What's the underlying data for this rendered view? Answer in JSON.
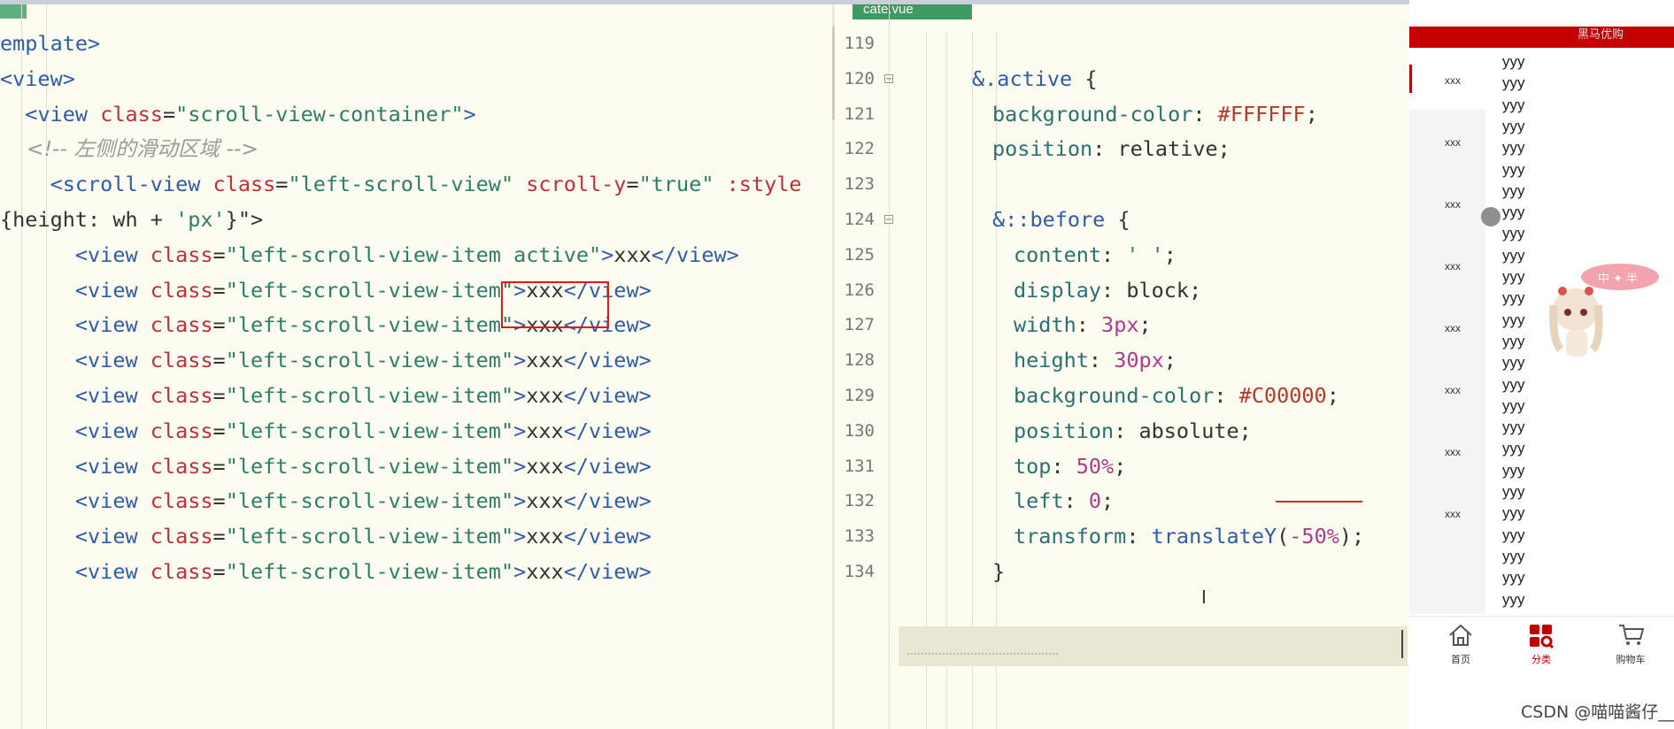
{
  "left_editor": {
    "lines": [
      {
        "parts": [
          [
            "tag",
            "emplate>"
          ]
        ]
      },
      {
        "parts": [
          [
            "tag",
            "<view>"
          ]
        ]
      },
      {
        "parts": [
          [
            "tag",
            "  <view "
          ],
          [
            "attr",
            "class"
          ],
          [
            "txt",
            "="
          ],
          [
            "str",
            "\"scroll-view-container\""
          ],
          [
            "tag",
            ">"
          ]
        ]
      },
      {
        "parts": [
          [
            "comment",
            "    <!-- 左侧的滑动区域 -->"
          ]
        ]
      },
      {
        "parts": [
          [
            "tag",
            "    <scroll-view "
          ],
          [
            "attr",
            "class"
          ],
          [
            "txt",
            "="
          ],
          [
            "str",
            "\"left-scroll-view\""
          ],
          [
            "txt",
            " "
          ],
          [
            "attr",
            "scroll-y"
          ],
          [
            "txt",
            "="
          ],
          [
            "str",
            "\"true\""
          ],
          [
            "txt",
            " "
          ],
          [
            "attr",
            ":style"
          ]
        ]
      },
      {
        "parts": [
          [
            "txt",
            "{height: wh + "
          ],
          [
            "str",
            "'px'"
          ],
          [
            "txt",
            "}\">"
          ]
        ]
      },
      {
        "parts": [
          [
            "tag",
            "      <view "
          ],
          [
            "attr",
            "class"
          ],
          [
            "txt",
            "="
          ],
          [
            "str",
            "\"left-scroll-view-item active\""
          ],
          [
            "tag",
            ">"
          ],
          [
            "txt",
            "xxx"
          ],
          [
            "tag",
            "</view>"
          ]
        ]
      },
      {
        "parts": [
          [
            "tag",
            "      <view "
          ],
          [
            "attr",
            "class"
          ],
          [
            "txt",
            "="
          ],
          [
            "str",
            "\"left-scroll-view-item\""
          ],
          [
            "tag",
            ">"
          ],
          [
            "txt",
            "xxx"
          ],
          [
            "tag",
            "</view>"
          ]
        ]
      },
      {
        "parts": [
          [
            "tag",
            "      <view "
          ],
          [
            "attr",
            "class"
          ],
          [
            "txt",
            "="
          ],
          [
            "str",
            "\"left-scroll-view-item\""
          ],
          [
            "tag",
            ">"
          ],
          [
            "txt",
            "xxx"
          ],
          [
            "tag",
            "</view>"
          ]
        ]
      },
      {
        "parts": [
          [
            "tag",
            "      <view "
          ],
          [
            "attr",
            "class"
          ],
          [
            "txt",
            "="
          ],
          [
            "str",
            "\"left-scroll-view-item\""
          ],
          [
            "tag",
            ">"
          ],
          [
            "txt",
            "xxx"
          ],
          [
            "tag",
            "</view>"
          ]
        ]
      },
      {
        "parts": [
          [
            "tag",
            "      <view "
          ],
          [
            "attr",
            "class"
          ],
          [
            "txt",
            "="
          ],
          [
            "str",
            "\"left-scroll-view-item\""
          ],
          [
            "tag",
            ">"
          ],
          [
            "txt",
            "xxx"
          ],
          [
            "tag",
            "</view>"
          ]
        ]
      },
      {
        "parts": [
          [
            "tag",
            "      <view "
          ],
          [
            "attr",
            "class"
          ],
          [
            "txt",
            "="
          ],
          [
            "str",
            "\"left-scroll-view-item\""
          ],
          [
            "tag",
            ">"
          ],
          [
            "txt",
            "xxx"
          ],
          [
            "tag",
            "</view>"
          ]
        ]
      },
      {
        "parts": [
          [
            "tag",
            "      <view "
          ],
          [
            "attr",
            "class"
          ],
          [
            "txt",
            "="
          ],
          [
            "str",
            "\"left-scroll-view-item\""
          ],
          [
            "tag",
            ">"
          ],
          [
            "txt",
            "xxx"
          ],
          [
            "tag",
            "</view>"
          ]
        ]
      },
      {
        "parts": [
          [
            "tag",
            "      <view "
          ],
          [
            "attr",
            "class"
          ],
          [
            "txt",
            "="
          ],
          [
            "str",
            "\"left-scroll-view-item\""
          ],
          [
            "tag",
            ">"
          ],
          [
            "txt",
            "xxx"
          ],
          [
            "tag",
            "</view>"
          ]
        ]
      },
      {
        "parts": [
          [
            "tag",
            "      <view "
          ],
          [
            "attr",
            "class"
          ],
          [
            "txt",
            "="
          ],
          [
            "str",
            "\"left-scroll-view-item\""
          ],
          [
            "tag",
            ">"
          ],
          [
            "txt",
            "xxx"
          ],
          [
            "tag",
            "</view>"
          ]
        ]
      },
      {
        "parts": [
          [
            "tag",
            "      <view "
          ],
          [
            "attr",
            "class"
          ],
          [
            "txt",
            "="
          ],
          [
            "str",
            "\"left-scroll-view-item\""
          ],
          [
            "tag",
            ">"
          ],
          [
            "txt",
            "xxx"
          ],
          [
            "tag",
            "</view>"
          ]
        ]
      }
    ]
  },
  "right_editor": {
    "file_tab": "cate.vue",
    "lines": [
      {
        "no": "119",
        "fold": false,
        "parts": []
      },
      {
        "no": "120",
        "fold": true,
        "parts": [
          [
            "sel",
            "&.active"
          ],
          [
            "txt",
            " {"
          ]
        ]
      },
      {
        "no": "121",
        "fold": false,
        "parts": [
          [
            "prop",
            "background-color"
          ],
          [
            "txt",
            ": "
          ],
          [
            "hex",
            "#FFFFFF"
          ],
          [
            "txt",
            ";"
          ]
        ]
      },
      {
        "no": "122",
        "fold": false,
        "parts": [
          [
            "prop",
            "position"
          ],
          [
            "txt",
            ": relative;"
          ]
        ]
      },
      {
        "no": "123",
        "fold": false,
        "parts": []
      },
      {
        "no": "124",
        "fold": true,
        "parts": [
          [
            "sel",
            "&::before"
          ],
          [
            "txt",
            " {"
          ]
        ]
      },
      {
        "no": "125",
        "fold": false,
        "parts": [
          [
            "prop",
            "content"
          ],
          [
            "txt",
            ": "
          ],
          [
            "str",
            "' '"
          ],
          [
            "txt",
            ";"
          ]
        ]
      },
      {
        "no": "126",
        "fold": false,
        "parts": [
          [
            "prop",
            "display"
          ],
          [
            "txt",
            ": block;"
          ]
        ]
      },
      {
        "no": "127",
        "fold": false,
        "parts": [
          [
            "prop",
            "width"
          ],
          [
            "txt",
            ": "
          ],
          [
            "num",
            "3px"
          ],
          [
            "txt",
            ";"
          ]
        ]
      },
      {
        "no": "128",
        "fold": false,
        "parts": [
          [
            "prop",
            "height"
          ],
          [
            "txt",
            ": "
          ],
          [
            "num",
            "30px"
          ],
          [
            "txt",
            ";"
          ]
        ]
      },
      {
        "no": "129",
        "fold": false,
        "parts": [
          [
            "prop",
            "background-color"
          ],
          [
            "txt",
            ": "
          ],
          [
            "hex",
            "#C00000"
          ],
          [
            "txt",
            ";"
          ]
        ]
      },
      {
        "no": "130",
        "fold": false,
        "parts": [
          [
            "prop",
            "position"
          ],
          [
            "txt",
            ": absolute;"
          ]
        ]
      },
      {
        "no": "131",
        "fold": false,
        "parts": [
          [
            "prop",
            "top"
          ],
          [
            "txt",
            ": "
          ],
          [
            "num",
            "50%"
          ],
          [
            "txt",
            ";"
          ]
        ]
      },
      {
        "no": "132",
        "fold": false,
        "parts": [
          [
            "prop",
            "left"
          ],
          [
            "txt",
            ": "
          ],
          [
            "num",
            "0"
          ],
          [
            "txt",
            ";"
          ]
        ]
      },
      {
        "no": "133",
        "fold": false,
        "parts": [
          [
            "prop",
            "transform"
          ],
          [
            "txt",
            ": "
          ],
          [
            "sel",
            "translateY"
          ],
          [
            "txt",
            "("
          ],
          [
            "num",
            "-50%"
          ],
          [
            "txt",
            ");"
          ]
        ]
      },
      {
        "no": "134",
        "fold": false,
        "parts": [
          [
            "txt",
            "}"
          ]
        ]
      }
    ]
  },
  "preview": {
    "header_text": "黑马优购",
    "left_items": [
      "xxx",
      "xxx",
      "xxx",
      "xxx",
      "xxx",
      "xxx",
      "xxx",
      "xxx"
    ],
    "right_item_text": "yyy",
    "right_item_count": 26,
    "tabs": [
      {
        "label": "首页",
        "icon": "home-icon",
        "active": false
      },
      {
        "label": "分类",
        "icon": "category-icon",
        "active": true
      },
      {
        "label": "购物车",
        "icon": "cart-icon",
        "active": false
      }
    ],
    "active_color": "#C00000"
  },
  "mascot_badge": "中 ✦ 半",
  "watermark": "CSDN @喵喵酱仔__"
}
